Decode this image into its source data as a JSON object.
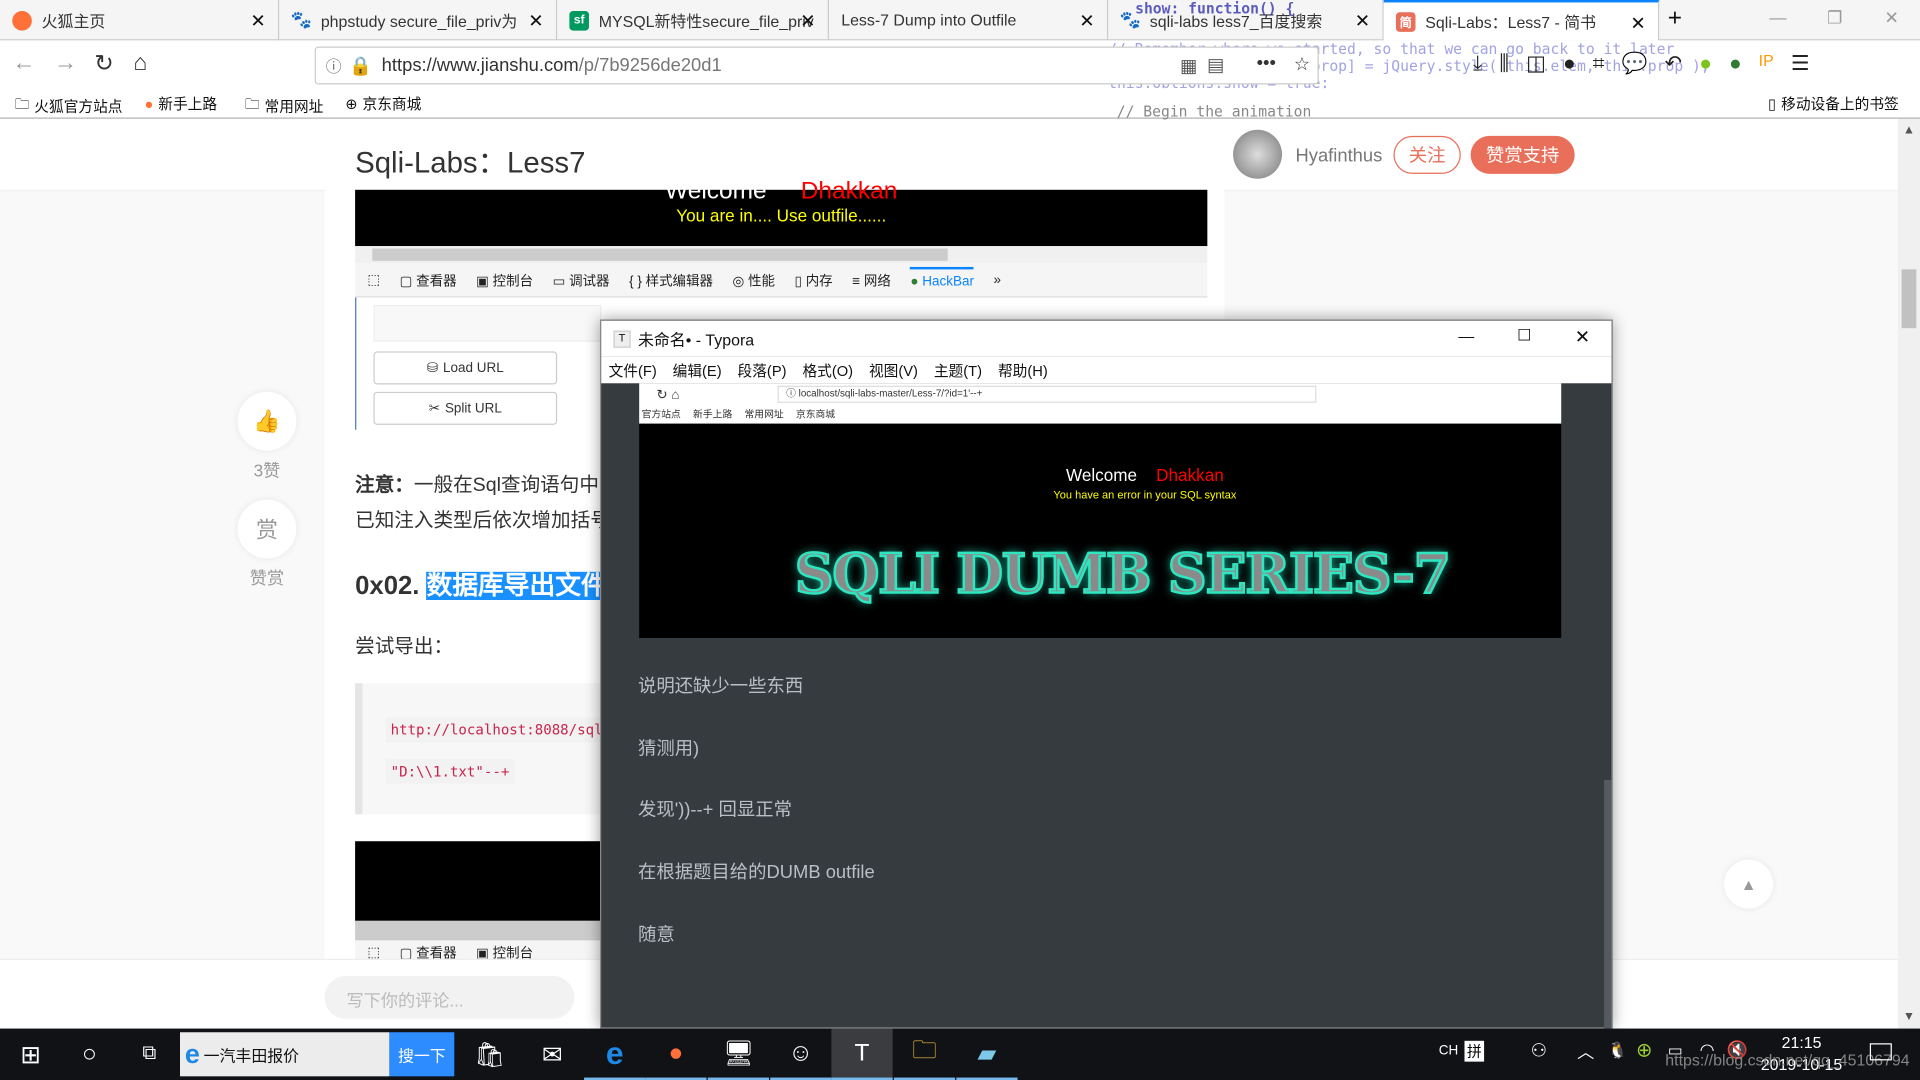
{
  "browser": {
    "tabs": [
      {
        "title": "火狐主页",
        "icon": "firefox-icon"
      },
      {
        "title": "phpstudy secure_file_priv为",
        "icon": "baidu-icon"
      },
      {
        "title": "MYSQL新特性secure_file_priv",
        "icon": "segmentfault-icon"
      },
      {
        "title": "Less-7 Dump into Outfile",
        "icon": ""
      },
      {
        "title": "sqli-labs less7_百度搜索",
        "icon": "baidu-icon"
      },
      {
        "title": "Sqli-Labs：Less7 - 简书",
        "icon": "jianshu-icon",
        "active": true
      }
    ],
    "url": "https://www.jianshu.com/p/7b9256de20d1",
    "url_host": "https://www.jianshu.com",
    "url_path": "/p/7b9256de20d1",
    "bookmarks": [
      "火狐官方站点",
      "新手上路",
      "常用网址",
      "京东商城"
    ],
    "mobile_bookmarks": "移动设备上的书签",
    "bg_code": [
      "show: function() {",
      "// Remember where we started, so that we can go back to it later",
      "this.options.orig[this.prop] = jQuery.style( this.elem, this.prop );",
      "this.options.show = true;",
      "// Begin the animation"
    ]
  },
  "article": {
    "title": "Sqli-Labs：Less7",
    "author": "Hyafinthus",
    "follow_label": "关注",
    "support_label": "赞赏支持",
    "like_count": "3赞",
    "reward_icon_text": "赏",
    "reward_label": "赞赏",
    "shot1": {
      "welcome": "Welcome",
      "name": "Dhakkan",
      "message": "You are in.... Use outfile......",
      "devtools": [
        "查看器",
        "控制台",
        "调试器",
        "样式编辑器",
        "性能",
        "内存",
        "网络",
        "HackBar"
      ],
      "load_url": "Load URL",
      "split_url": "Split URL"
    },
    "note_label": "注意：",
    "note_line1": "一般在Sql查询语句中",
    "note_line2": "已知注入类型后依次增加括号",
    "heading_prefix": "0x02.",
    "heading_highlight": "数据库导出文件",
    "try_export": "尝试导出：",
    "code_line1": "http://localhost:8088/sqli",
    "code_line2": "\"D:\\\\1.txt\"--+",
    "shot2_devtools": [
      "查看器",
      "控制台"
    ],
    "comment_placeholder": "写下你的评论..."
  },
  "typora": {
    "title": "未命名• - Typora",
    "menu": [
      "文件(F)",
      "编辑(E)",
      "段落(P)",
      "格式(O)",
      "视图(V)",
      "主题(T)",
      "帮助(H)"
    ],
    "inner_url": "localhost/sqli-labs-master/Less-7/?id=1'--+",
    "inner_bookmarks": [
      "官方站点",
      "新手上路",
      "常用网址",
      "京东商城"
    ],
    "welcome": "Welcome",
    "name": "Dhakkan",
    "error": "You have an error in your SQL syntax",
    "banner": "SQLI DUMB SERIES-7",
    "paragraphs": [
      "说明还缺少一些东西",
      "猜测用)",
      "发现'))--+ 回显正常",
      "在根据题目给的DUMB outfile",
      "随意"
    ]
  },
  "taskbar": {
    "search_text": "一汽丰田报价",
    "search_button": "搜一下",
    "ime_lang": "CH",
    "ime_mode": "拼",
    "time": "21:15",
    "date": "2019-10-15",
    "watermark": "https://blog.csdn.net/qq_45106794"
  },
  "colors": {
    "accent_orange": "#ea6f5a",
    "highlight_blue": "#1890ff",
    "typora_bg": "#363b40",
    "code_red": "#c7254e",
    "hackbar_blue": "#0a84ff"
  }
}
